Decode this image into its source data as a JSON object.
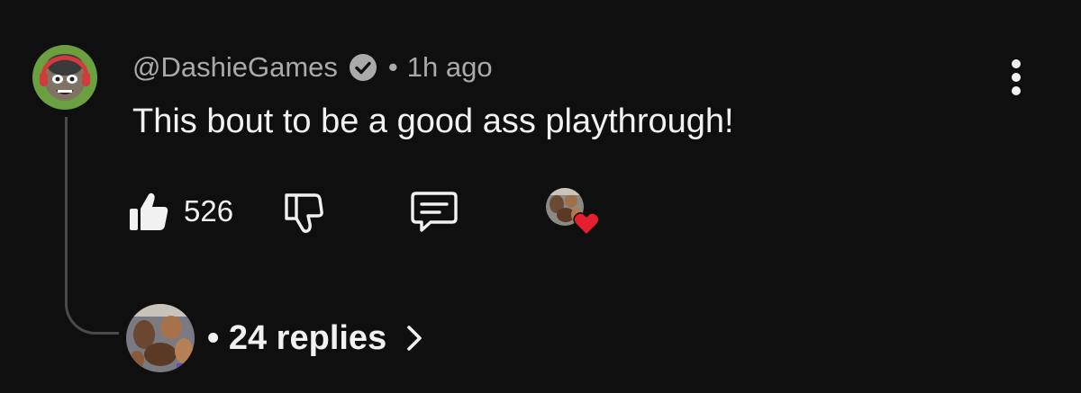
{
  "comment": {
    "author": "@DashieGames",
    "separator": "•",
    "timestamp": "1h ago",
    "text": "This bout to be a good ass playthrough!",
    "like_count": "526"
  },
  "replies": {
    "label": "• 24 replies"
  },
  "colors": {
    "background": "#0f0f0f",
    "primary_text": "#f1f1f1",
    "secondary_text": "#aaaaaa",
    "heart": "#e5202e",
    "thread_line": "#4a4a4a"
  },
  "icons": {
    "verified": "check-circle-icon",
    "more": "vertical-dots-icon",
    "like": "thumbs-up-filled-icon",
    "dislike": "thumbs-down-outline-icon",
    "reply": "comment-bubble-icon",
    "creator_heart": "heart-icon",
    "chevron": "chevron-right-icon"
  }
}
